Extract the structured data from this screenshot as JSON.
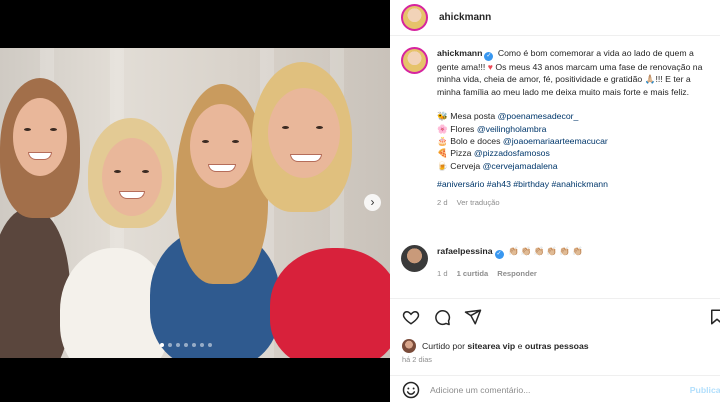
{
  "post": {
    "author": "ahickmann",
    "verified_mark": "✓",
    "caption": {
      "username": "ahickmann",
      "text_1": "Como é bom comemorar a vida ao lado de quem a gente ama!!!",
      "heart": "♥",
      "text_2": "Os meus 43 anos marcam uma fase de renovação na minha vida, cheia de amor, fé, positividade e gratidão 🙏🏼!!! E ter a minha família ao meu lado me deixa muito mais forte e mais feliz.",
      "credits": [
        {
          "emoji": "🐝",
          "label": "Mesa posta",
          "handle": "@poenamesadecor_"
        },
        {
          "emoji": "🌸",
          "label": "Flores",
          "handle": "@veilingholambra"
        },
        {
          "emoji": "🎂",
          "label": "Bolo e doces",
          "handle": "@joaoemariaarteemacucar"
        },
        {
          "emoji": "🍕",
          "label": "Pizza",
          "handle": "@pizzadosfamosos"
        },
        {
          "emoji": "🍺",
          "label": "Cerveja",
          "handle": "@cervejamadalena"
        }
      ],
      "hashtags": "#aniversário #ah43 #birthday #anahickmann",
      "age": "2 d",
      "translate": "Ver tradução"
    },
    "comment": {
      "username": "rafaelpessina",
      "text": "👏🏼👏🏼👏🏼👏🏼👏🏼👏🏼",
      "age": "1 d",
      "likes": "1 curtida",
      "reply": "Responder"
    },
    "likes": {
      "prefix": "Curtido por",
      "user": "sitearea vip",
      "middle": "e",
      "others": "outras pessoas"
    },
    "posted": "há 2 dias",
    "add_comment": {
      "placeholder": "Adicione um comentário...",
      "publish": "Publicar"
    },
    "carousel": {
      "count": 7,
      "active": 0,
      "next": "›"
    }
  },
  "colors": {
    "accent": "#3897f0",
    "heart": "#ed4956",
    "link": "#00376b",
    "muted": "#8e8e8e"
  },
  "icons": [
    "heart-icon",
    "comment-icon",
    "share-icon",
    "bookmark-icon",
    "emoji-icon",
    "chevron-right-icon"
  ]
}
